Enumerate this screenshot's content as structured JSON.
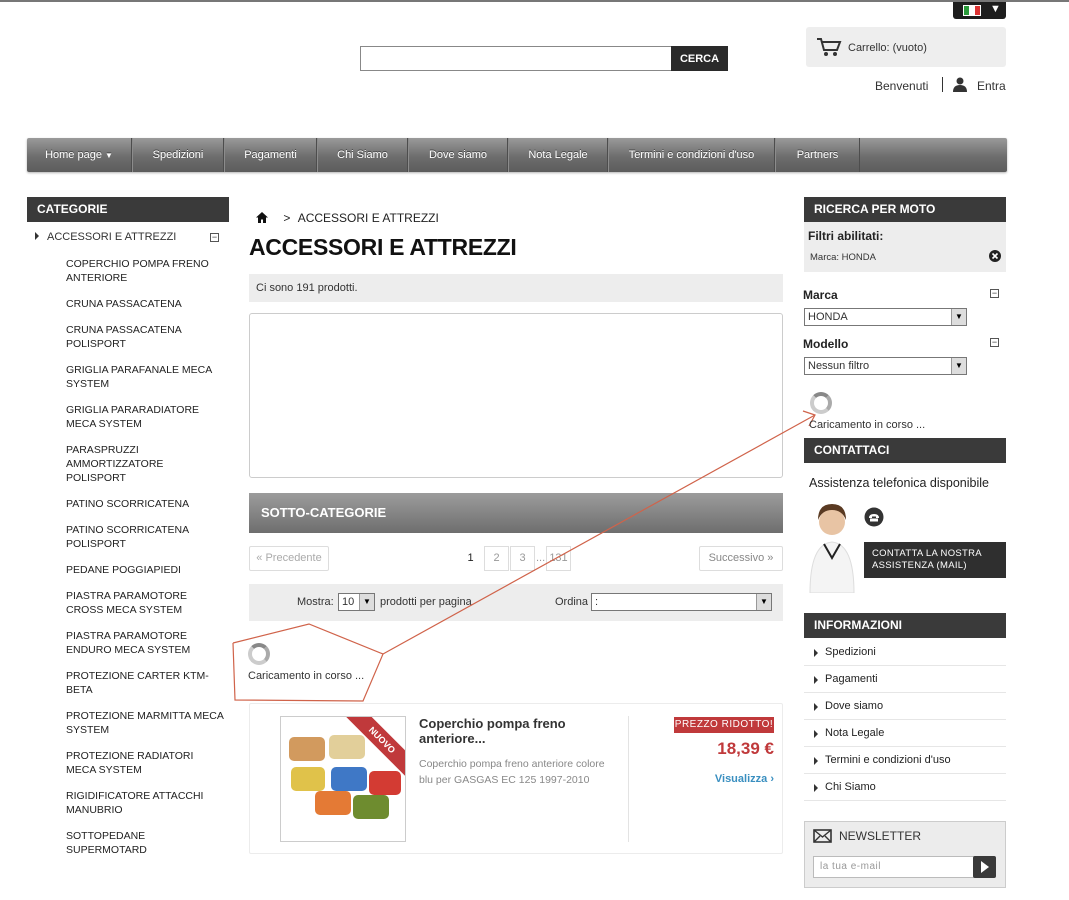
{
  "header": {
    "search_button": "CERCA",
    "search_placeholder": "",
    "cart_text": "Carrello: (vuoto)",
    "welcome": "Benvenuti",
    "login": "Entra"
  },
  "menu": [
    {
      "label": "Home page",
      "has_dropdown": true
    },
    {
      "label": "Spedizioni"
    },
    {
      "label": "Pagamenti"
    },
    {
      "label": "Chi Siamo"
    },
    {
      "label": "Dove siamo"
    },
    {
      "label": "Nota Legale"
    },
    {
      "label": "Termini e condizioni d'uso"
    },
    {
      "label": "Partners"
    }
  ],
  "categories": {
    "title": "CATEGORIE",
    "current": "ACCESSORI E ATTREZZI",
    "items": [
      "COPERCHIO POMPA FRENO ANTERIORE",
      "CRUNA PASSACATENA",
      "CRUNA PASSACATENA POLISPORT",
      "GRIGLIA PARAFANALE MECA SYSTEM",
      "GRIGLIA PARARADIATORE MECA SYSTEM",
      "PARASPRUZZI AMMORTIZZATORE POLISPORT",
      "PATINO SCORRICATENA",
      "PATINO SCORRICATENA POLISPORT",
      "PEDANE POGGIAPIEDI",
      "PIASTRA PARAMOTORE CROSS MECA SYSTEM",
      "PIASTRA PARAMOTORE ENDURO MECA SYSTEM",
      "PROTEZIONE CARTER KTM-BETA",
      "PROTEZIONE MARMITTA MECA SYSTEM",
      "PROTEZIONE RADIATORI MECA SYSTEM",
      "RIGIDIFICATORE ATTACCHI MANUBRIO",
      "SOTTOPEDANE SUPERMOTARD"
    ]
  },
  "content": {
    "breadcrumb_sep": ">",
    "breadcrumb_current": "ACCESSORI E ATTREZZI",
    "title": "ACCESSORI E ATTREZZI",
    "count_text": "Ci sono 191 prodotti.",
    "subcategories_title": "SOTTO-CATEGORIE",
    "pagination": {
      "prev": "« Precedente",
      "next": "Successivo »",
      "current": "1",
      "pages": [
        "2",
        "3"
      ],
      "ellipsis": "...",
      "last": "131"
    },
    "show_label": "Mostra:",
    "show_value": "10",
    "per_page_label": "prodotti per pagina",
    "order_label": "Ordina",
    "order_value": ":",
    "loading": "Caricamento in corso ..."
  },
  "product": {
    "name": "Coperchio pompa freno anteriore...",
    "description": "Coperchio pompa freno anteriore colore blu per GASGAS EC 125 1997-2010",
    "ribbon": "NUOVO",
    "badge": "PREZZO RIDOTTO!",
    "price": "18,39 €",
    "view": "Visualizza"
  },
  "moto_search": {
    "title": "RICERCA PER MOTO",
    "filters_label": "Filtri abilitati:",
    "filter_value": "Marca: HONDA",
    "brand_label": "Marca",
    "brand_value": "HONDA",
    "model_label": "Modello",
    "model_value": "Nessun filtro",
    "loading": "Caricamento in corso ..."
  },
  "contact": {
    "title": "CONTATTACI",
    "phone_text": "Assistenza telefonica disponibile",
    "button": "CONTATTA LA NOSTRA ASSISTENZA (MAIL)"
  },
  "info": {
    "title": "INFORMAZIONI",
    "items": [
      "Spedizioni",
      "Pagamenti",
      "Dove siamo",
      "Nota Legale",
      "Termini e condizioni d'uso",
      "Chi Siamo"
    ]
  },
  "newsletter": {
    "title": "NEWSLETTER",
    "placeholder": "la tua e-mail"
  },
  "colors": {
    "accent_red": "#c0393b",
    "link_blue": "#3a8fc0",
    "header_dark": "#3a3a3a"
  }
}
